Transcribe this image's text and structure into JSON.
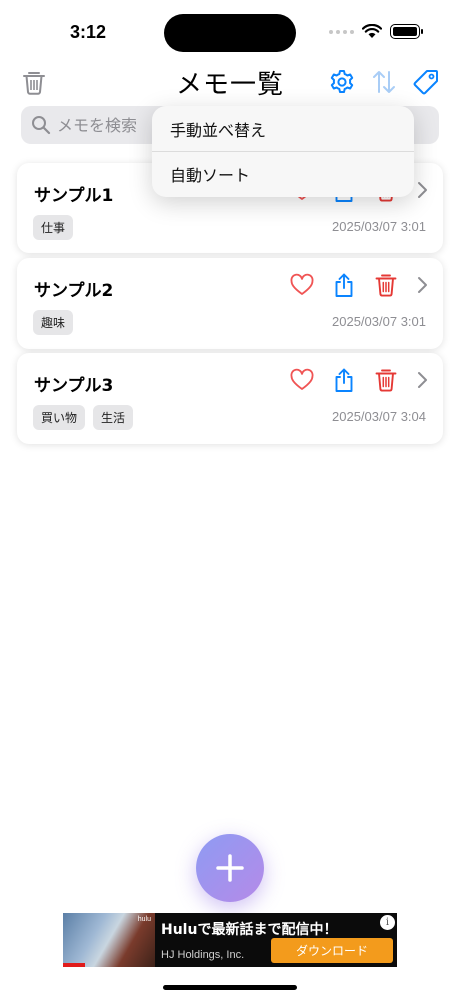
{
  "status_bar": {
    "time": "3:12"
  },
  "nav": {
    "title": "メモ一覧"
  },
  "search": {
    "placeholder": "メモを検索"
  },
  "sort_menu": {
    "items": [
      {
        "label": "手動並べ替え"
      },
      {
        "label": "自動ソート"
      }
    ]
  },
  "memos": [
    {
      "title": "サンプル1",
      "tags": [
        "仕事"
      ],
      "date": "2025/03/07 3:01"
    },
    {
      "title": "サンプル2",
      "tags": [
        "趣味"
      ],
      "date": "2025/03/07 3:01"
    },
    {
      "title": "サンプル3",
      "tags": [
        "買い物",
        "生活"
      ],
      "date": "2025/03/07 3:04"
    }
  ],
  "ad": {
    "brand": "hulu",
    "headline": "Huluで最新話まで配信中！",
    "company": "HJ Holdings, Inc.",
    "cta": "ダウンロード",
    "info": "i"
  },
  "colors": {
    "accent": "#0a84ff",
    "accent_faded": "#a9cdf6",
    "heart": "#f05454",
    "delete": "#e53935",
    "chevron": "#8e8e93",
    "fab_start": "#8e9bf3",
    "fab_end": "#b58ae8",
    "cta": "#f39b1c"
  },
  "icons": {
    "trash_nav": "trash-icon",
    "settings": "gear-icon",
    "sort": "sort-arrows-icon",
    "tag": "tag-icon",
    "search": "magnifier-icon",
    "favorite": "heart-icon",
    "share": "share-icon",
    "delete": "trash-icon",
    "open": "chevron-right-icon",
    "add": "plus-icon"
  }
}
